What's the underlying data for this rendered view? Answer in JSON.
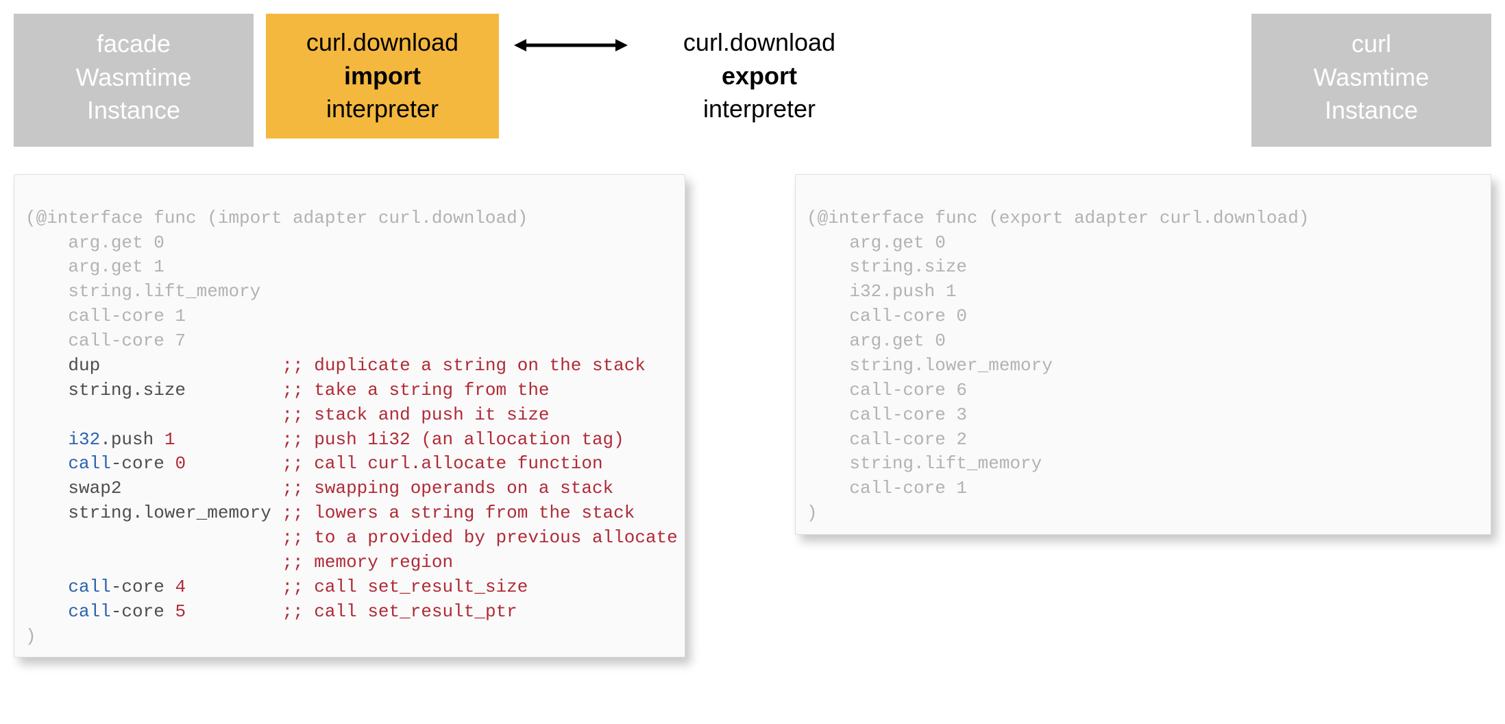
{
  "top": {
    "left_gray": {
      "line1": "facade",
      "line2": "Wasmtime Instance"
    },
    "yellow": {
      "line1": "curl.download",
      "bold": "import",
      "after_bold": " interpreter"
    },
    "white": {
      "line1": "curl.download",
      "bold": "export",
      "after_bold": " interpreter"
    },
    "right_gray": {
      "line1": "curl",
      "line2": "Wasmtime Instance"
    }
  },
  "left_code": {
    "header": "(@interface func (import adapter curl.download)",
    "dim_lines": [
      "    arg.get 0",
      "    arg.get 1",
      "    string.lift_memory",
      "    call-core 1",
      "    call-core 7"
    ],
    "lines": [
      {
        "col1_plain": "    dup",
        "comment": ";; duplicate a string on the stack"
      },
      {
        "col1_plain": "    string.size",
        "comment": ";; take a string from the"
      },
      {
        "col1_plain": "",
        "comment": ";; stack and push it size"
      },
      {
        "col1_kw": "    i32",
        "col1_fn": ".push ",
        "col1_num": "1",
        "comment": ";; push 1i32 (an allocation tag)"
      },
      {
        "col1_kw": "    call",
        "col1_fn": "-core ",
        "col1_num": "0",
        "comment": ";; call curl.allocate function"
      },
      {
        "col1_plain": "    swap2",
        "comment": ";; swapping operands on a stack"
      },
      {
        "col1_plain": "    string.lower_memory",
        "comment": ";; lowers a string from the stack"
      },
      {
        "col1_plain": "",
        "comment": ";; to a provided by previous allocate"
      },
      {
        "col1_plain": "",
        "comment": ";; memory region"
      },
      {
        "col1_kw": "    call",
        "col1_fn": "-core ",
        "col1_num": "4",
        "comment": ";; call set_result_size"
      },
      {
        "col1_kw": "    call",
        "col1_fn": "-core ",
        "col1_num": "5",
        "comment": ";; call set_result_ptr"
      }
    ],
    "footer": ")"
  },
  "right_code": {
    "header": "(@interface func (export adapter curl.download)",
    "dim_lines": [
      "    arg.get 0",
      "    string.size",
      "    i32.push 1",
      "    call-core 0",
      "    arg.get 0",
      "    string.lower_memory",
      "    call-core 6",
      "    call-core 3",
      "    call-core 2",
      "    string.lift_memory",
      "    call-core 1"
    ],
    "footer": ")"
  }
}
